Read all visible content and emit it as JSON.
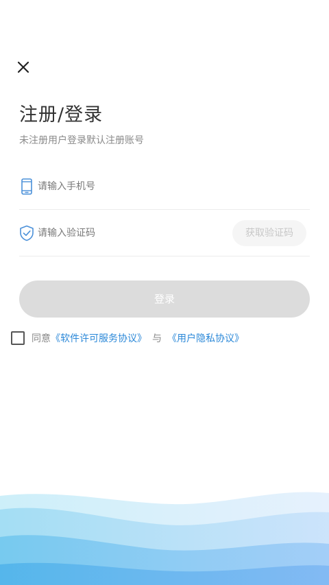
{
  "header": {
    "title": "注册/登录",
    "subtitle": "未注册用户登录默认注册账号"
  },
  "form": {
    "phone_placeholder": "请输入手机号",
    "code_placeholder": "请输入验证码",
    "get_code_label": "获取验证码",
    "login_label": "登录"
  },
  "agreement": {
    "agree_text": "同意",
    "software_license_link": "《软件许可服务协议》",
    "and_text": "与",
    "privacy_link": "《用户隐私协议》"
  },
  "icons": {
    "close": "close-icon",
    "phone": "phone-icon",
    "shield": "shield-check-icon",
    "checkbox": "checkbox-icon"
  },
  "colors": {
    "link": "#2b88d8",
    "icon_blue": "#4a90d9",
    "button_disabled": "#dcdcdc"
  }
}
